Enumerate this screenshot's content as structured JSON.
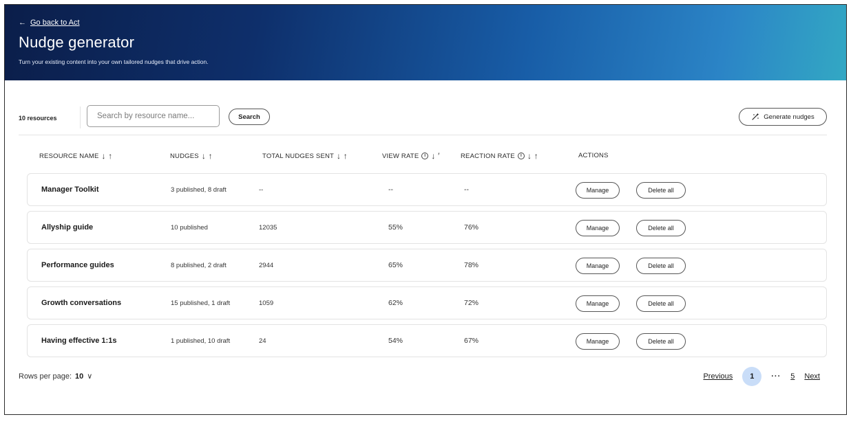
{
  "header": {
    "back_arrow": "←",
    "back_label": "Go back to Act",
    "title": "Nudge generator",
    "subtitle": "Turn your existing content into your own tailored nudges that drive action."
  },
  "toolbar": {
    "resource_count": "10 resources",
    "search_placeholder": "Search by resource name...",
    "search_label": "Search",
    "generate_label": "Generate nudges",
    "generate_icon": "magic-wand-icon"
  },
  "table": {
    "columns": [
      {
        "label": "RESOURCE NAME",
        "sort": "↓ ↑"
      },
      {
        "label": "NUDGES",
        "sort": "↓ ↑"
      },
      {
        "label": "TOTAL NUDGES SENT",
        "sort": "↓ ↑"
      },
      {
        "label": "VIEW RATE",
        "info": "i",
        "sort": "↓ ′"
      },
      {
        "label": "REACTION RATE",
        "info": "i",
        "sort": "↓ ↑"
      },
      {
        "label": "ACTIONS"
      }
    ],
    "rows": [
      {
        "name": "Manager Toolkit",
        "nudges": "3 published, 8 draft",
        "sent": "--",
        "view": "--",
        "reaction": "--"
      },
      {
        "name": "Allyship guide",
        "nudges": "10 published",
        "sent": "12035",
        "view": "55%",
        "reaction": "76%"
      },
      {
        "name": "Performance guides",
        "nudges": "8 published, 2 draft",
        "sent": "2944",
        "view": "65%",
        "reaction": "78%"
      },
      {
        "name": "Growth conversations",
        "nudges": "15 published, 1 draft",
        "sent": "1059",
        "view": "62%",
        "reaction": "72%"
      },
      {
        "name": "Having effective 1:1s",
        "nudges": "1 published, 10 draft",
        "sent": "24",
        "view": "54%",
        "reaction": "67%"
      }
    ],
    "manage_label": "Manage",
    "delete_label": "Delete all"
  },
  "footer": {
    "rows_label": "Rows per page:",
    "rows_value": "10",
    "rows_chevron": "∨",
    "previous": "Previous",
    "current_page": "1",
    "ellipsis": "···",
    "last_page": "5",
    "next": "Next"
  },
  "colors": {
    "header_gradient_start": "#0b1e4a",
    "header_gradient_end": "#33a8c4",
    "current_page_bg": "#c9ddf8"
  }
}
